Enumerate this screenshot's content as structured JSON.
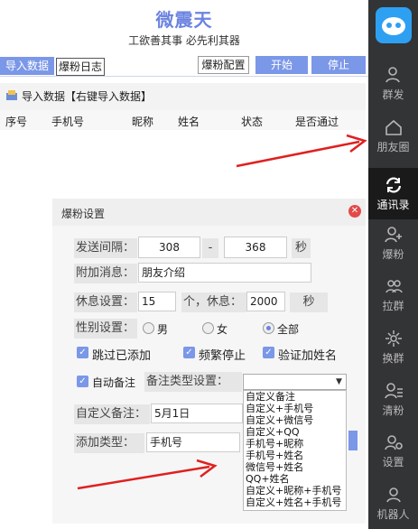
{
  "header": {
    "title": "微震天",
    "subtitle": "工欲善其事 必先利其器"
  },
  "tabs": {
    "import": "导入数据",
    "log": "爆粉日志"
  },
  "toolbar": {
    "config": "爆粉配置",
    "start": "开始",
    "stop": "停止"
  },
  "panel": {
    "hint": "导入数据【右键导入数据】"
  },
  "table": {
    "columns": [
      "序号",
      "手机号",
      "昵称",
      "姓名",
      "状态",
      "是否通过"
    ]
  },
  "sidebar": {
    "items": [
      {
        "label": "群发",
        "icon": "user-mass-icon"
      },
      {
        "label": "朋友圈",
        "icon": "moments-icon"
      },
      {
        "label": "通讯录",
        "icon": "contacts-sync-icon"
      },
      {
        "label": "爆粉",
        "icon": "add-user-icon"
      },
      {
        "label": "拉群",
        "icon": "group-icon"
      },
      {
        "label": "换群",
        "icon": "switch-group-icon"
      },
      {
        "label": "清粉",
        "icon": "clean-fans-icon"
      },
      {
        "label": "设置",
        "icon": "settings-icon"
      },
      {
        "label": "机器人",
        "icon": "robot-icon"
      }
    ],
    "active": "通讯录"
  },
  "dialog": {
    "title": "爆粉设置",
    "interval": {
      "label": "发送间隔：",
      "min": "308",
      "dash": "-",
      "max": "368",
      "unit": "秒"
    },
    "message": {
      "label": "附加消息：",
      "value": "朋友介绍"
    },
    "rest": {
      "label": "休息设置：",
      "count": "15",
      "mid": "个，休息：",
      "seconds": "2000",
      "unit": "秒"
    },
    "gender": {
      "label": "性别设置：",
      "options": [
        "男",
        "女",
        "全部"
      ],
      "selected": "全部"
    },
    "checks": {
      "skip": "跳过已添加",
      "frequent": "频繁停止",
      "verify_name": "验证加姓名",
      "auto_note": "自动备注"
    },
    "note_type": {
      "label": "备注类型设置：",
      "value": ""
    },
    "custom_note": {
      "label": "自定义备注：",
      "value": "5月1日"
    },
    "add_type": {
      "label": "添加类型：",
      "value": "手机号"
    },
    "dropdown_options": [
      "自定义备注",
      "自定义+手机号",
      "自定义+微信号",
      "自定义+QQ",
      "手机号+昵称",
      "手机号+姓名",
      "微信号+姓名",
      "QQ+姓名",
      "自定义+昵称+手机号",
      "自定义+姓名+手机号"
    ]
  },
  "colors": {
    "accent": "#7b97e8",
    "sidebar": "#333436",
    "close": "#e34a4a",
    "arrow": "#e02020"
  }
}
